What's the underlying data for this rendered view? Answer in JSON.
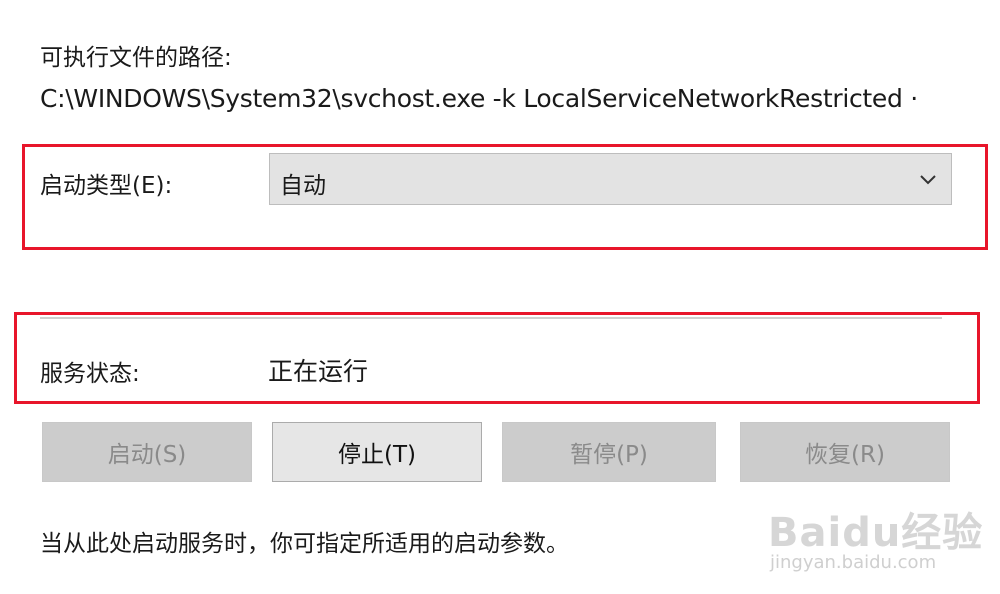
{
  "executable": {
    "label": "可执行文件的路径:",
    "path": "C:\\WINDOWS\\System32\\svchost.exe -k LocalServiceNetworkRestricted ·"
  },
  "startup": {
    "label": "启动类型(E):",
    "selected": "自动",
    "icon": "chevron-down-icon"
  },
  "service_status": {
    "label": "服务状态:",
    "value": "正在运行"
  },
  "buttons": {
    "start": "启动(S)",
    "stop": "停止(T)",
    "pause": "暂停(P)",
    "resume": "恢复(R)"
  },
  "hint": "当从此处启动服务时，你可指定所适用的启动参数。",
  "watermark": {
    "brand": "Baidu经验",
    "url": "jingyan.baidu.com"
  },
  "colors": {
    "highlight": "#e8152a",
    "button_disabled": "#cccccc",
    "button_enabled": "#e6e6e6"
  }
}
